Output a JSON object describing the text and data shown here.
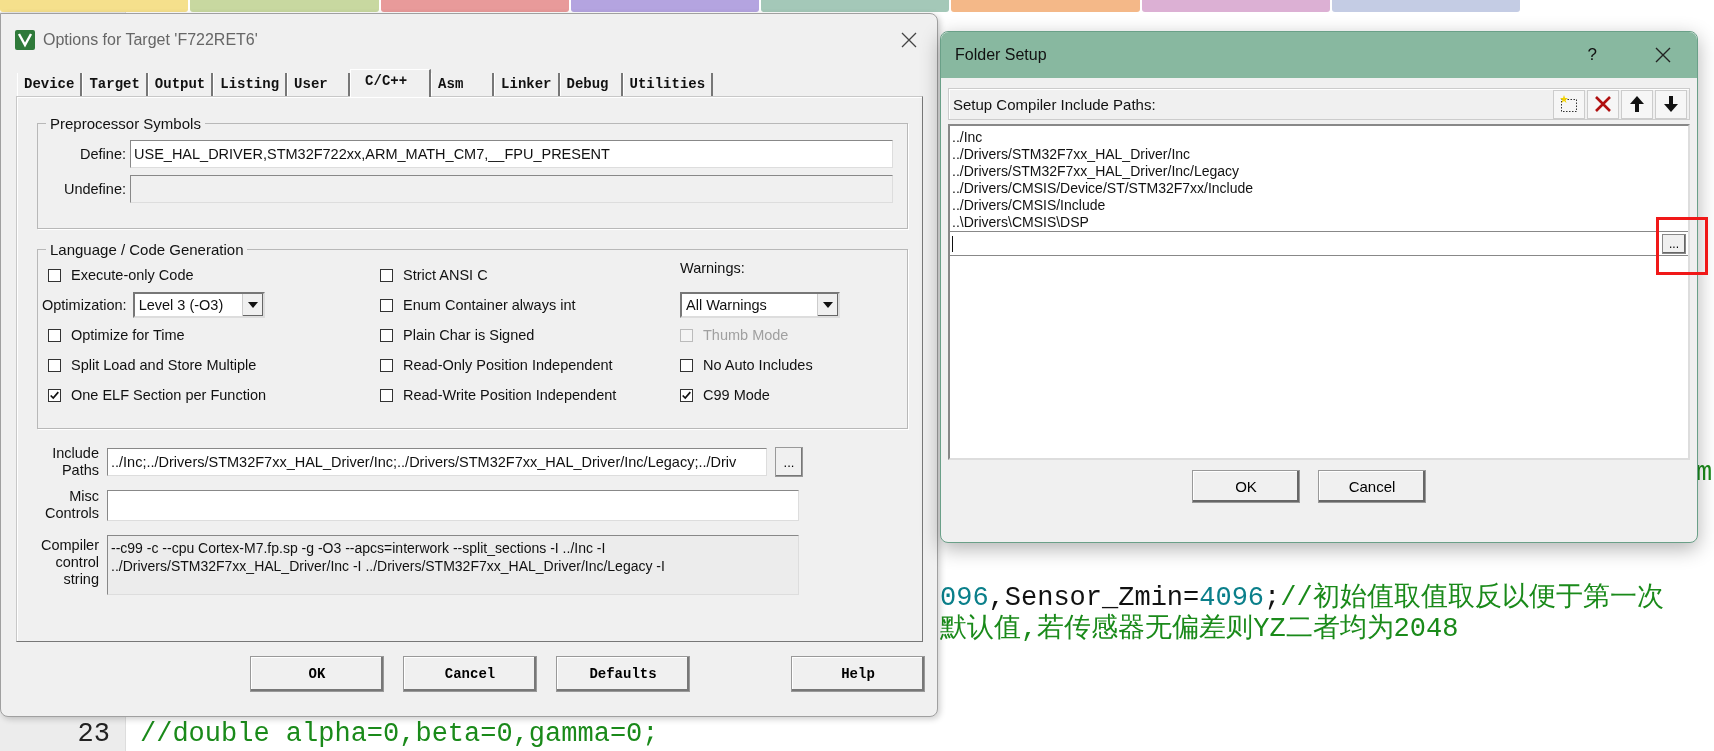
{
  "editor_tabs": [
    {
      "color": "#f5e08c"
    },
    {
      "color": "#c8d8a0"
    },
    {
      "color": "#e89a9a"
    },
    {
      "color": "#b4a4e0"
    },
    {
      "color": "#a4c8b8"
    },
    {
      "color": "#f4b888"
    },
    {
      "color": "#dcb0d4"
    },
    {
      "color": "#c4cce4"
    }
  ],
  "editor": {
    "fragments": [
      {
        "parts": [
          {
            "kind": "comment",
            "text": "m"
          }
        ]
      },
      {
        "parts": [
          {
            "kind": "number",
            "text": "096"
          },
          {
            "kind": "plain",
            "text": ",Sensor_Zmin="
          },
          {
            "kind": "number",
            "text": "4096"
          },
          {
            "kind": "plain",
            "text": ";"
          },
          {
            "kind": "comment",
            "text": "//初始值取值取反以便于第一次"
          }
        ]
      },
      {
        "parts": [
          {
            "kind": "comment",
            "text": "默认值,若传感器无偏差则YZ二者均为2048"
          }
        ]
      },
      {
        "number": "23",
        "parts": [
          {
            "kind": "comment",
            "text": "//double alpha=0,beta=0,gamma=0;"
          }
        ]
      }
    ]
  },
  "options_dialog": {
    "title": "Options for Target 'F722RET6'",
    "tabs": [
      {
        "label": "Device",
        "selected": false
      },
      {
        "label": "Target",
        "selected": false
      },
      {
        "label": "Output",
        "selected": false
      },
      {
        "label": "Listing",
        "selected": false
      },
      {
        "label": "User",
        "selected": false
      },
      {
        "label": "C/C++",
        "selected": true
      },
      {
        "label": "Asm",
        "selected": false
      },
      {
        "label": "Linker",
        "selected": false
      },
      {
        "label": "Debug",
        "selected": false
      },
      {
        "label": "Utilities",
        "selected": false
      }
    ],
    "preprocessor": {
      "title": "Preprocessor Symbols",
      "fields": [
        {
          "label": "Define:",
          "value": "USE_HAL_DRIVER,STM32F722xx,ARM_MATH_CM7,__FPU_PRESENT",
          "disabled": false
        },
        {
          "label": "Undefine:",
          "disabled": true
        }
      ]
    },
    "language": {
      "title": "Language / Code Generation",
      "column_1": [
        {
          "kind": "checkbox",
          "label": "Execute-only Code",
          "checked": false,
          "disabled": false
        },
        {
          "kind": "dropdown",
          "label": "Optimization:",
          "value": "Level 3 (-O3)"
        },
        {
          "kind": "checkbox",
          "label": "Optimize for Time",
          "checked": false,
          "disabled": false
        },
        {
          "kind": "checkbox",
          "label": "Split Load and Store Multiple",
          "checked": false,
          "disabled": false
        },
        {
          "kind": "checkbox",
          "label": "One ELF Section per Function",
          "checked": true,
          "disabled": false
        }
      ],
      "column_2": [
        {
          "kind": "checkbox",
          "label": "Strict ANSI C",
          "checked": false,
          "disabled": false
        },
        {
          "kind": "checkbox",
          "label": "Enum Container always int",
          "checked": false,
          "disabled": false
        },
        {
          "kind": "checkbox",
          "label": "Plain Char is Signed",
          "checked": false,
          "disabled": false
        },
        {
          "kind": "checkbox",
          "label": "Read-Only Position Independent",
          "checked": false,
          "disabled": false
        },
        {
          "kind": "checkbox",
          "label": "Read-Write Position Independent",
          "checked": false,
          "disabled": false
        }
      ],
      "column_3": [
        {
          "kind": "heading",
          "label": "Warnings:"
        },
        {
          "kind": "dropdown",
          "value": "All Warnings"
        },
        {
          "kind": "checkbox",
          "label": "Thumb Mode",
          "checked": false,
          "disabled": true
        },
        {
          "kind": "checkbox",
          "label": "No Auto Includes",
          "checked": false,
          "disabled": false
        },
        {
          "kind": "checkbox",
          "label": "C99 Mode",
          "checked": true,
          "disabled": false
        }
      ]
    },
    "include_paths": {
      "label": "Include Paths",
      "value": "../Inc;../Drivers/STM32F7xx_HAL_Driver/Inc;../Drivers/STM32F7xx_HAL_Driver/Inc/Legacy;../Driv",
      "browse_button": "..."
    },
    "misc_controls": {
      "label": "Misc Controls"
    },
    "compiler_string": {
      "label": "Compiler control string",
      "lines": [
        "--c99 -c --cpu Cortex-M7.fp.sp -g -O3 --apcs=interwork --split_sections -I ../Inc -I",
        "../Drivers/STM32F7xx_HAL_Driver/Inc -I ../Drivers/STM32F7xx_HAL_Driver/Inc/Legacy -I"
      ]
    },
    "buttons": [
      {
        "label": "OK"
      },
      {
        "label": "Cancel"
      },
      {
        "label": "Defaults"
      },
      {
        "label": "Help"
      }
    ]
  },
  "folder_setup": {
    "title": "Folder Setup",
    "help": "?",
    "header": "Setup Compiler Include Paths:",
    "paths": [
      "../Inc",
      "../Drivers/STM32F7xx_HAL_Driver/Inc",
      "../Drivers/STM32F7xx_HAL_Driver/Inc/Legacy",
      "../Drivers/CMSIS/Device/ST/STM32F7xx/Include",
      "../Drivers/CMSIS/Include",
      "..\\Drivers\\CMSIS\\DSP"
    ],
    "browse_button": {
      "label": "...",
      "highlighted": true
    },
    "buttons": [
      {
        "label": "OK"
      },
      {
        "label": "Cancel"
      }
    ]
  }
}
